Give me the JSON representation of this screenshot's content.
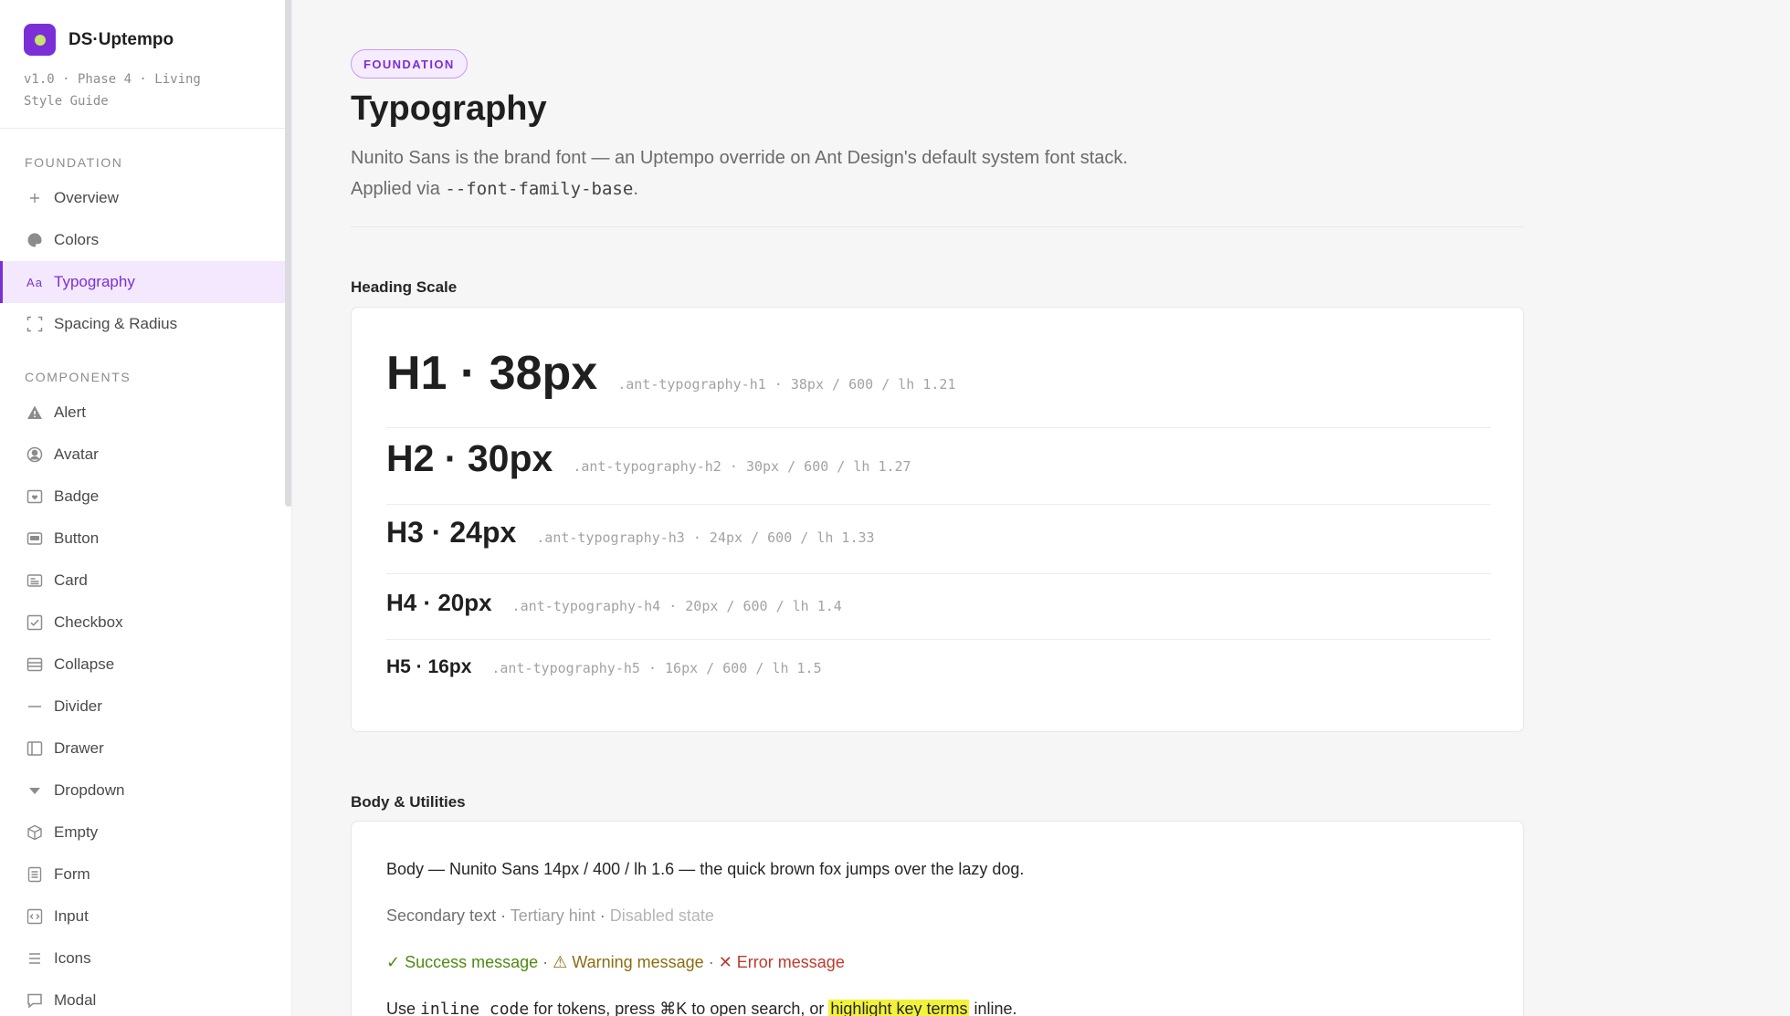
{
  "brand": {
    "name": "DS·Uptempo",
    "subtitle": "v1.0 · Phase 4 · Living Style Guide"
  },
  "sidebar": {
    "sections": [
      {
        "label": "FOUNDATION",
        "items": [
          {
            "label": "Overview",
            "icon": "plus-icon"
          },
          {
            "label": "Colors",
            "icon": "palette-icon"
          },
          {
            "label": "Typography",
            "icon": "typography-icon",
            "active": true
          },
          {
            "label": "Spacing & Radius",
            "icon": "corners-icon"
          }
        ]
      },
      {
        "label": "COMPONENTS",
        "items": [
          {
            "label": "Alert",
            "icon": "warning-triangle-icon"
          },
          {
            "label": "Avatar",
            "icon": "user-circle-icon"
          },
          {
            "label": "Badge",
            "icon": "badge-icon"
          },
          {
            "label": "Button",
            "icon": "button-icon"
          },
          {
            "label": "Card",
            "icon": "card-icon"
          },
          {
            "label": "Checkbox",
            "icon": "checkbox-icon"
          },
          {
            "label": "Collapse",
            "icon": "collapse-icon"
          },
          {
            "label": "Divider",
            "icon": "divider-icon"
          },
          {
            "label": "Drawer",
            "icon": "drawer-icon"
          },
          {
            "label": "Dropdown",
            "icon": "caret-down-icon"
          },
          {
            "label": "Empty",
            "icon": "box-icon"
          },
          {
            "label": "Form",
            "icon": "form-icon"
          },
          {
            "label": "Input",
            "icon": "input-icon"
          },
          {
            "label": "Icons",
            "icon": "list-icon"
          },
          {
            "label": "Modal",
            "icon": "modal-icon"
          }
        ]
      }
    ]
  },
  "header": {
    "tag": "FOUNDATION",
    "title": "Typography",
    "desc_prefix": "Nunito Sans is the brand font — an Uptempo override on Ant Design's default system font stack. Applied via ",
    "desc_code": "--font-family-base",
    "desc_suffix": "."
  },
  "heading_scale": {
    "title": "Heading Scale",
    "rows": [
      {
        "label": "H1 · 38px",
        "spec": ".ant-typography-h1 · 38px / 600 / lh 1.21"
      },
      {
        "label": "H2 · 30px",
        "spec": ".ant-typography-h2 · 30px / 600 / lh 1.27"
      },
      {
        "label": "H3 · 24px",
        "spec": ".ant-typography-h3 · 24px / 600 / lh 1.33"
      },
      {
        "label": "H4 · 20px",
        "spec": ".ant-typography-h4 · 20px / 600 / lh 1.4"
      },
      {
        "label": "H5 · 16px",
        "spec": ".ant-typography-h5 · 16px / 600 / lh 1.5"
      }
    ]
  },
  "body_utilities": {
    "title": "Body & Utilities",
    "body_text": "Body — Nunito Sans 14px / 400 / lh 1.6 — the quick brown fox jumps over the lazy dog.",
    "secondary": "Secondary text",
    "sep": " · ",
    "tertiary": "Tertiary hint",
    "disabled": "Disabled state",
    "success": "✓ Success message",
    "warning": "⚠ Warning message",
    "error": "✕ Error message",
    "use_prefix": "Use ",
    "use_code": "inline code",
    "use_mid": " for tokens, press ⌘K to open search, or ",
    "use_highlight": "highlight key terms",
    "use_suffix": " inline."
  }
}
